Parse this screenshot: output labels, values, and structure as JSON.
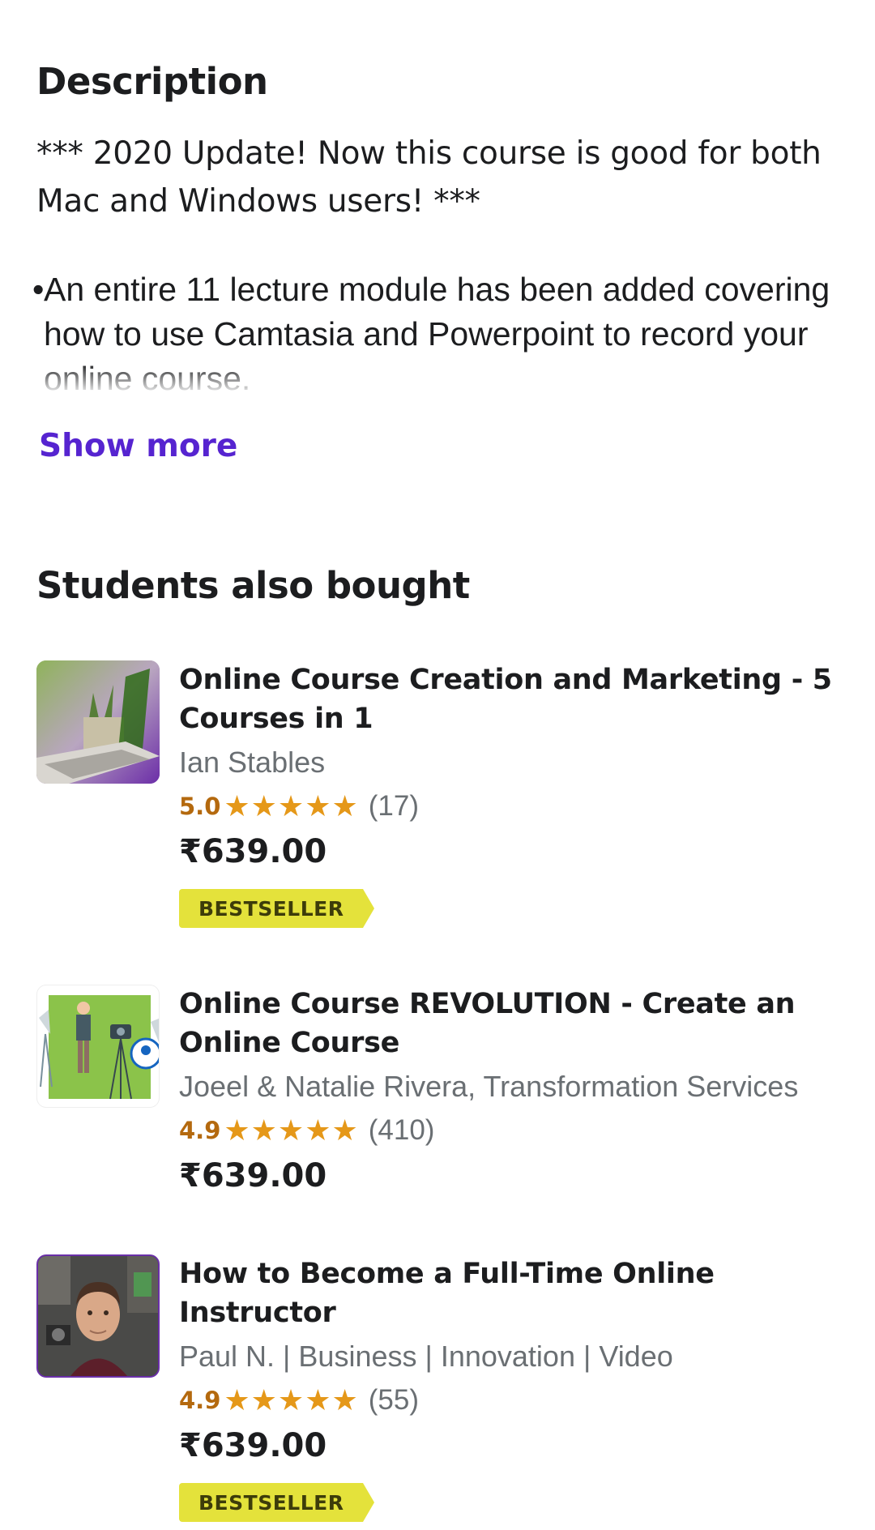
{
  "description": {
    "heading": "Description",
    "intro": "*** 2020 Update! Now this course is good for both Mac and Windows users! ***",
    "bullet_marker": "•",
    "bullet": "An entire 11 lecture module has been added covering how to use Camtasia and Powerpoint to record your online course.",
    "show_more": "Show more"
  },
  "also_bought": {
    "heading": "Students also bought",
    "courses": [
      {
        "title": "Online Course Creation and Marketing - 5 Courses in 1",
        "author": "Ian Stables",
        "rating": "5.0",
        "stars": "★★★★★",
        "count": "(17)",
        "price": "₹639.00",
        "badge": "BESTSELLER"
      },
      {
        "title": "Online Course REVOLUTION - Create an Online Course",
        "author": "Joeel & Natalie Rivera, Transformation Services",
        "rating": "4.9",
        "stars": "★★★★★",
        "count": "(410)",
        "price": "₹639.00"
      },
      {
        "title": "How to Become a Full-Time Online Instructor",
        "author": "Paul N. | Business | Innovation | Video",
        "rating": "4.9",
        "stars": "★★★★★",
        "count": "(55)",
        "price": "₹639.00",
        "badge": "BESTSELLER"
      }
    ]
  },
  "colors": {
    "link": "#5624d0",
    "rating": "#b4690e",
    "star": "#e59819",
    "badge": "#e4e23b",
    "muted": "#6a6f73"
  }
}
